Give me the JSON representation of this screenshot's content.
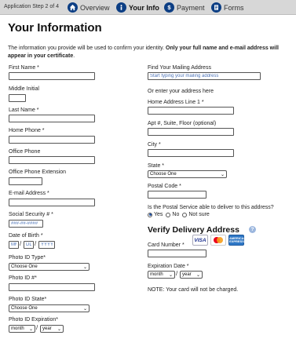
{
  "topbar": {
    "step_text": "Application Step 2 of 4",
    "nav": [
      {
        "label": "Overview",
        "icon": "home-icon"
      },
      {
        "label": "Your Info",
        "icon": "info-icon"
      },
      {
        "label": "Payment",
        "icon": "dollar-icon"
      },
      {
        "label": "Forms",
        "icon": "forms-icon"
      }
    ]
  },
  "page": {
    "title": "Your Information",
    "intro_text": "The information you provide will be used to confirm your identity. ",
    "intro_bold": "Only your full name and e-mail address will appear in your certificate",
    "intro_end": "."
  },
  "left": {
    "first_name": "First Name *",
    "middle_initial": "Middle Initial",
    "last_name": "Last Name *",
    "home_phone": "Home Phone *",
    "office_phone": "Office Phone",
    "office_ext": "Office Phone Extension",
    "email": "E-mail Address *",
    "ssn": "Social Security # *",
    "ssn_placeholder": "###-##-####",
    "dob": "Date of Birth *",
    "dob_mm": "MM",
    "dob_dd": "DD",
    "dob_yyyy": "YYYY",
    "photo_id_type": "Photo ID Type*",
    "photo_id_type_value": "Choose One",
    "photo_id_num": "Photo ID #*",
    "photo_id_state": "Photo ID State*",
    "photo_id_state_value": "Choose One",
    "photo_id_exp": "Photo ID Expiration*",
    "month_value": "month",
    "year_value": "year"
  },
  "right": {
    "find_address": "Find Your Mailing Address",
    "find_placeholder": "Start typing your mailing address",
    "or_enter": "Or enter your address here",
    "address1": "Home Address Line 1 *",
    "apt": "Apt #, Suite, Floor (optional)",
    "city": "City *",
    "state": "State *",
    "state_value": "Choose One",
    "postal": "Postal Code *",
    "deliver_question": "Is the Postal Service able to deliver to this address?",
    "radio_yes": "Yes",
    "radio_no": "No",
    "radio_notsure": "Not sure",
    "selected_option": "Yes",
    "verify_heading": "Verify Delivery Address",
    "help_glyph": "?",
    "card_number": "Card Number *",
    "card_brands": {
      "visa": "VISA",
      "amex": "AMERICAN EXPRESS"
    },
    "expiration": "Expiration Date *",
    "month_value": "month",
    "year_value": "year",
    "note": "NOTE: Your card will not be charged."
  },
  "colors": {
    "nav_icon_bg": "#0c3e84",
    "topbar_bg": "#d7d7d7",
    "placeholder_text": "#4d74b8",
    "help_icon": "#9cb7de"
  }
}
